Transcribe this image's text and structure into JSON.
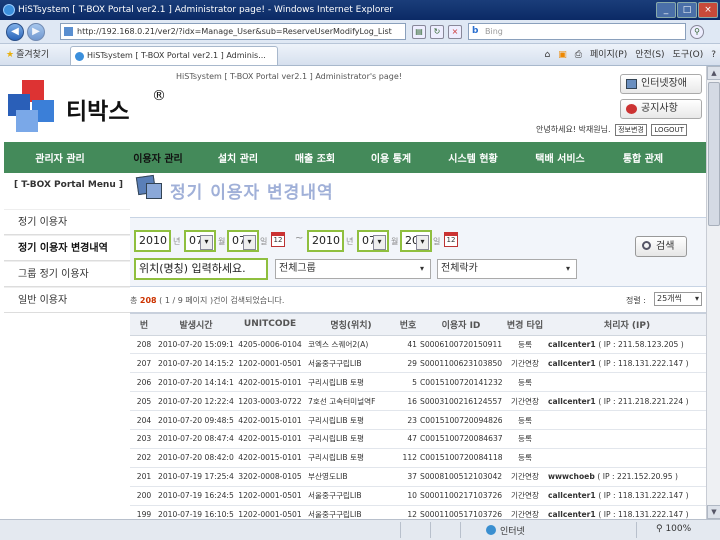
{
  "window": {
    "title": "HiSTsystem [ T-BOX Portal ver2.1 ] Administrator page! - Windows Internet Explorer"
  },
  "browser": {
    "url": "http://192.168.0.21/ver2/?idx=Manage_User&sub=ReserveUserModifyLog_List",
    "search_placeholder": "Bing",
    "favorites": "즐겨찾기",
    "tab": "HiSTsystem [ T-BOX Portal ver2.1 ] Adminis...",
    "tools": [
      "페이지(P)",
      "안전(S)",
      "도구(O)"
    ],
    "status": {
      "done": "",
      "zone": "인터넷",
      "zoom": "100%"
    }
  },
  "header": {
    "site_title": "HiSTsystem [ T-BOX Portal ver2.1 ] Administrator's page!",
    "logo_text": "티박스",
    "logo_reg": "®",
    "btn_fault": "인터넷장애",
    "btn_notice": "공지사항",
    "welcome": "안녕하세요! 박재원님.",
    "btn_profile": "정보변경",
    "btn_logout": "LOGOUT"
  },
  "gnav": [
    "관리자 관리",
    "이용자 관리",
    "설치 관리",
    "매출 조회",
    "이용 통계",
    "시스템 현황",
    "택배 서비스",
    "통합 관제"
  ],
  "sidebar": {
    "head": "[ T-BOX Portal Menu ]",
    "items": [
      "정기 이용자",
      "정기 이용자 변경내역",
      "그룹 정기 이용자",
      "일반 이용자"
    ]
  },
  "page": {
    "title": "정기 이용자 변경내역"
  },
  "filter": {
    "from_year": "2010",
    "from_month": "07",
    "from_day": "07",
    "to_year": "2010",
    "to_month": "07",
    "to_day": "20",
    "lbl_year": "년",
    "lbl_month": "월",
    "lbl_day": "일",
    "tilde": "~",
    "location": "위치(명칭) 입력하세요.",
    "group": "전체그룹",
    "locker": "전체락카",
    "search_btn": "검색"
  },
  "summary": {
    "pre": "총 ",
    "count": "208",
    "post": " ( 1 / 9 페이지 )건이 검색되었습니다."
  },
  "sort": {
    "label": "정렬 :",
    "value": "25개씩"
  },
  "table": {
    "headers": [
      "번",
      "발생시간",
      "UNITCODE",
      "명칭(위치)",
      "번호",
      "이용자 ID",
      "변경 타입",
      "처리자 (IP)"
    ],
    "rows": [
      [
        "208",
        "2010-07-20 15:09:11",
        "4205-0006-0104",
        "코엑스 스퀘어2(A)",
        "41",
        "S0006100720150911",
        "등록",
        "callcenter1",
        "( IP : 211.58.123.205 )"
      ],
      [
        "207",
        "2010-07-20 14:15:20",
        "1202-0001-0501",
        "서울중구구립LIB",
        "29",
        "S0001100623103850",
        "기간연장",
        "callcenter1",
        "( IP : 118.131.222.147 )"
      ],
      [
        "206",
        "2010-07-20 14:14:13",
        "4202-0015-0101",
        "구리시립LIB 토평",
        "5",
        "C0015100720141232",
        "등록",
        "",
        ""
      ],
      [
        "205",
        "2010-07-20 12:22:44",
        "1203-0003-0722",
        "7호선 고속터미널역F",
        "16",
        "S0003100216124557",
        "기간연장",
        "callcenter1",
        "( IP : 211.218.221.224 )"
      ],
      [
        "204",
        "2010-07-20 09:48:57",
        "4202-0015-0101",
        "구리시립LIB 토평",
        "23",
        "C0015100720094826",
        "등록",
        "",
        ""
      ],
      [
        "203",
        "2010-07-20 08:47:43",
        "4202-0015-0101",
        "구리시립LIB 토평",
        "47",
        "C0015100720084637",
        "등록",
        "",
        ""
      ],
      [
        "202",
        "2010-07-20 08:42:03",
        "4202-0015-0101",
        "구리시립LIB 토평",
        "112",
        "C0015100720084118",
        "등록",
        "",
        ""
      ],
      [
        "201",
        "2010-07-19 17:25:47",
        "3202-0008-0105",
        "부산영도LIB",
        "37",
        "S0008100512103042",
        "기간연장",
        "wwwchoeb",
        "( IP : 221.152.20.95 )"
      ],
      [
        "200",
        "2010-07-19 16:24:57",
        "1202-0001-0501",
        "서울중구구립LIB",
        "10",
        "S0001100217103726",
        "기간연장",
        "callcenter1",
        "( IP : 118.131.222.147 )"
      ],
      [
        "199",
        "2010-07-19 16:10:58",
        "1202-0001-0501",
        "서울중구구립LIB",
        "12",
        "S0001100517103726",
        "기간연장",
        "callcenter1",
        "( IP : 118.131.222.147 )"
      ]
    ]
  }
}
